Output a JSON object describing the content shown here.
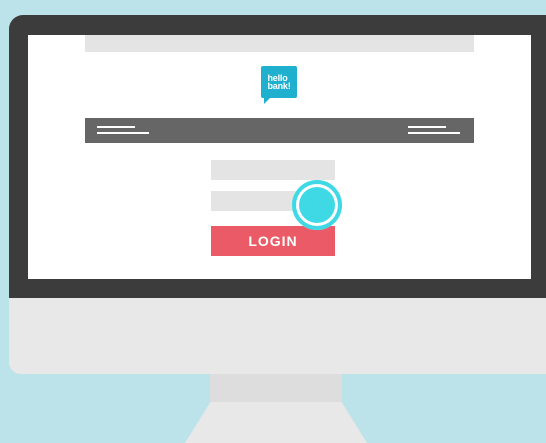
{
  "colors": {
    "background": "#bde3ea",
    "bezel": "#3c3c3c",
    "screen": "#ffffff",
    "placeholder_bar": "#e4e4e4",
    "navbar": "#666666",
    "logo": "#1fb0d0",
    "login_button": "#ea5b67",
    "touch_indicator": "#3fd9e6",
    "monitor_body": "#e8e8e8"
  },
  "logo": {
    "line1": "hello",
    "line2": "bank!"
  },
  "login": {
    "button_label": "LOGIN"
  },
  "icons": {
    "nav_left": "menu-lines-icon",
    "nav_right": "menu-lines-icon",
    "touch": "tap-indicator-icon"
  }
}
